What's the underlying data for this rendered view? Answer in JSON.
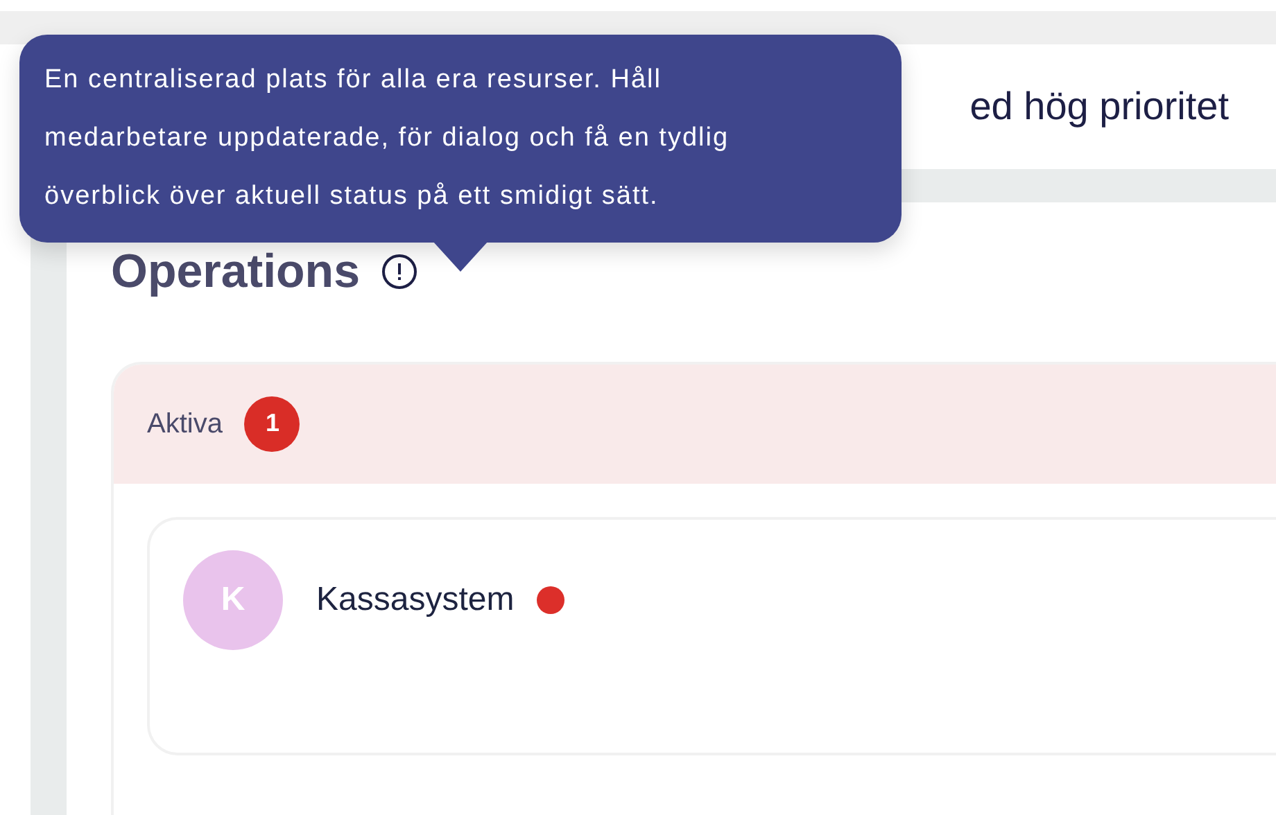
{
  "top_card": {
    "title": "ed hög prioritet"
  },
  "tooltip": {
    "text": "En centraliserad plats för alla era resurser. Håll medarbetare uppdaterade, för dialog och få en tydlig överblick över aktuell status på ett smidigt sätt."
  },
  "heading": {
    "title": "Operations"
  },
  "sections": [
    {
      "label": "Aktiva",
      "count": "1",
      "items": [
        {
          "initial": "K",
          "name": "Kassasystem",
          "color": "#dc2f2a"
        }
      ]
    }
  ]
}
